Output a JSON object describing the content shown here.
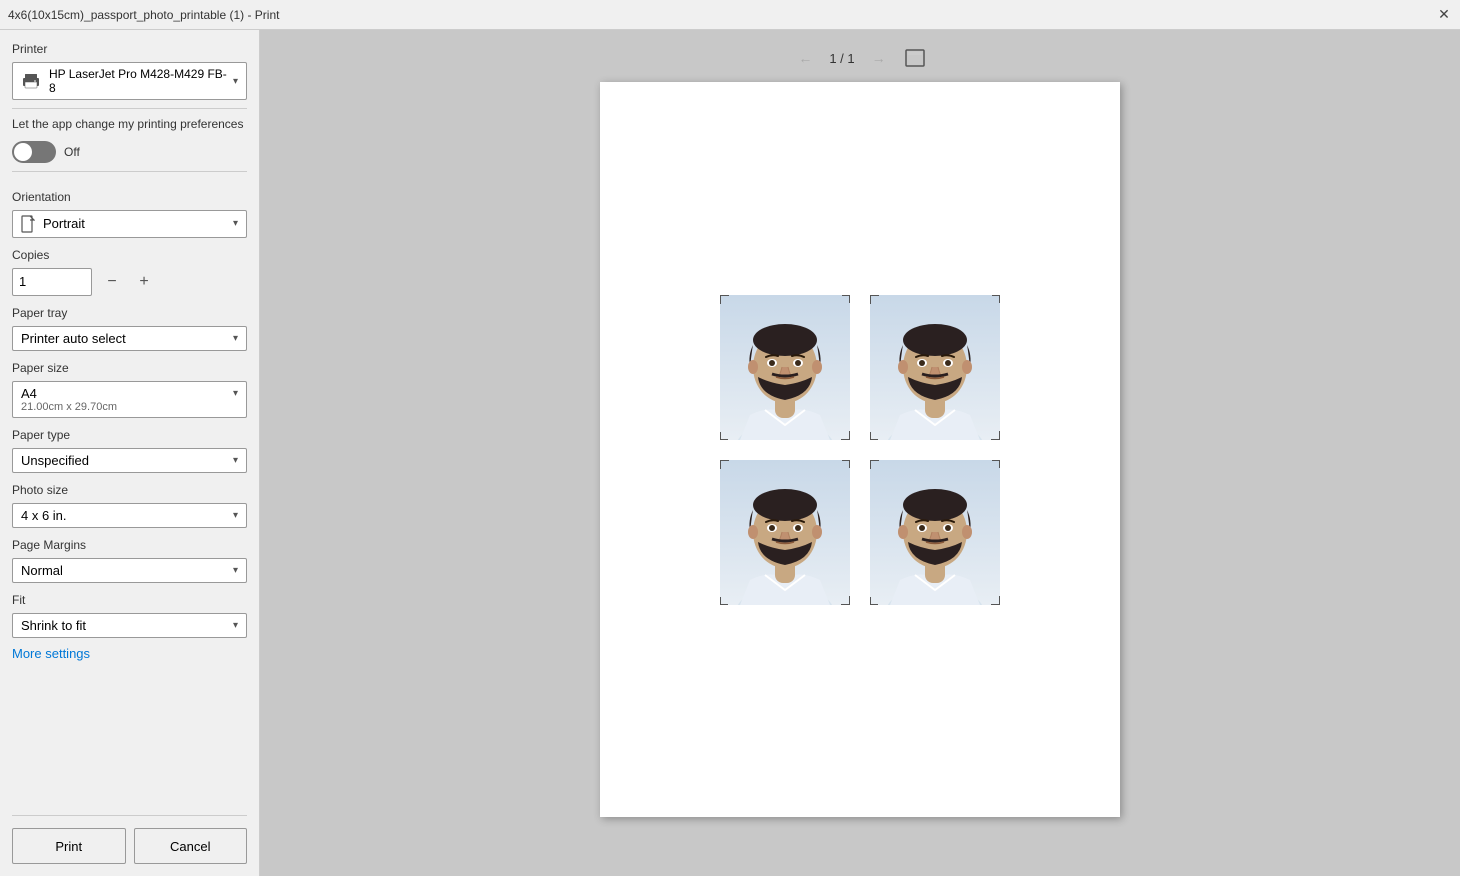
{
  "titleBar": {
    "title": "4x6(10x15cm)_passport_photo_printable (1) - Print"
  },
  "leftPanel": {
    "printerLabel": "Printer",
    "printerName": "HP LaserJet Pro M428-M429 FB-8",
    "letAppLabel": "Let the app change my printing preferences",
    "toggleState": "Off",
    "orientationLabel": "Orientation",
    "orientationValue": "Portrait",
    "copiesLabel": "Copies",
    "copiesValue": "1",
    "paperTrayLabel": "Paper tray",
    "paperTrayValue": "Printer auto select",
    "paperSizeLabel": "Paper size",
    "paperSizeValue": "A4",
    "paperSizeSub": "21.00cm x 29.70cm",
    "paperTypeLabel": "Paper type",
    "paperTypeValue": "Unspecified",
    "photoSizeLabel": "Photo size",
    "photoSizeValue": "4 x 6 in.",
    "pageMarginsLabel": "Page Margins",
    "pageMarginsValue": "Normal",
    "fitLabel": "Fit",
    "fitValue": "Shrink to fit",
    "moreSettingsLabel": "More settings",
    "printButton": "Print",
    "cancelButton": "Cancel"
  },
  "preview": {
    "pageIndicator": "1 / 1",
    "photoCount": 4
  }
}
